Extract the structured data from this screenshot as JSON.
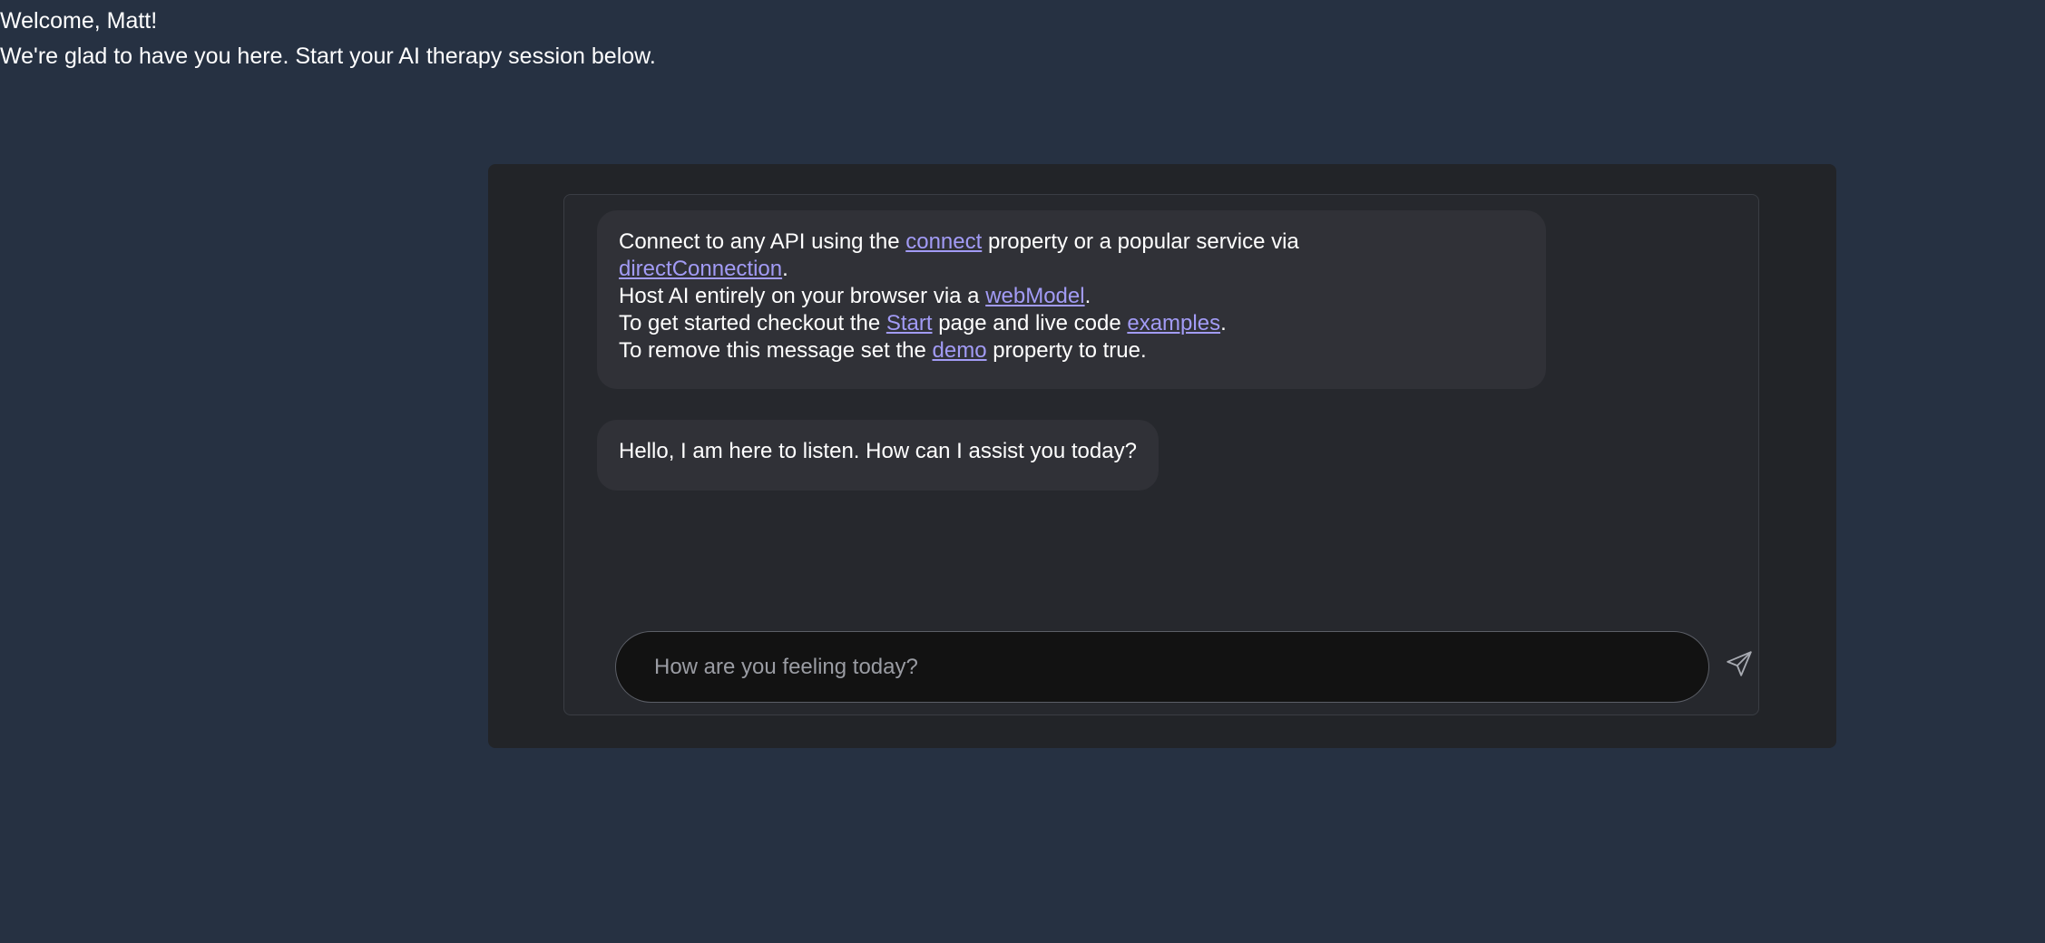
{
  "header": {
    "welcome": "Welcome, Matt!",
    "subtitle": "We're glad to have you here. Start your AI therapy session below."
  },
  "chat": {
    "intro": {
      "l1_pre": "Connect to any API using the ",
      "l1_link": "connect",
      "l1_post": " property or a popular service via",
      "l2_link": "directConnection",
      "l2_post": ".",
      "l3_pre": "Host AI entirely on your browser via a ",
      "l3_link": "webModel",
      "l3_post": ".",
      "l4_pre": "To get started checkout the ",
      "l4_link1": "Start",
      "l4_mid": " page and live code ",
      "l4_link2": "examples",
      "l4_post": ".",
      "l5_pre": "To remove this message set the ",
      "l5_link": "demo",
      "l5_post": " property to true."
    },
    "greeting": "Hello, I am here to listen. How can I assist you today?",
    "input": {
      "value": "",
      "placeholder": "How are you feeling today?"
    },
    "send_icon": "send-icon"
  },
  "colors": {
    "page_bg": "#263142",
    "panel_bg": "#222428",
    "chat_bg": "#26282d",
    "bubble_bg": "#303137",
    "link": "#a29bf5",
    "input_bg": "#121212"
  }
}
